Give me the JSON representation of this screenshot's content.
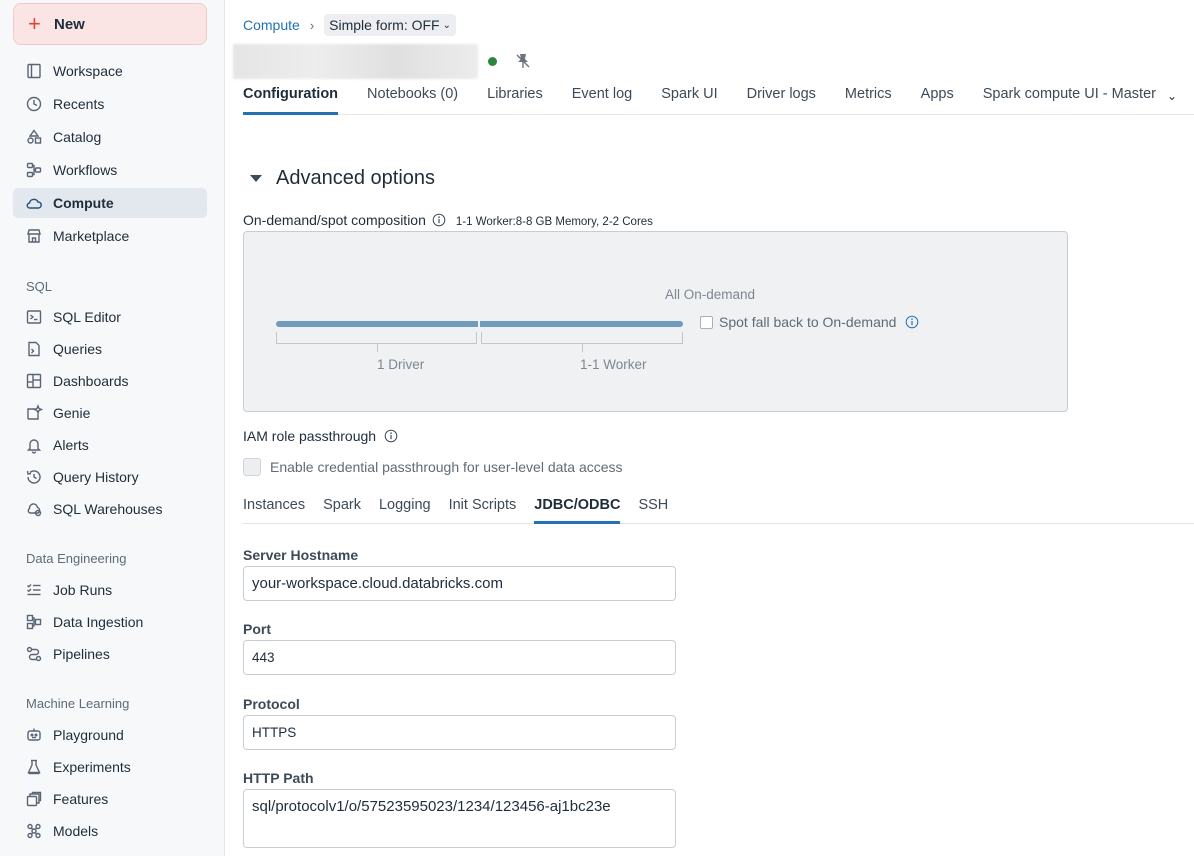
{
  "sidebar": {
    "new_label": "New",
    "items_top": [
      {
        "label": "Workspace",
        "icon": "workspace-icon"
      },
      {
        "label": "Recents",
        "icon": "clock-icon"
      },
      {
        "label": "Catalog",
        "icon": "catalog-icon"
      },
      {
        "label": "Workflows",
        "icon": "workflows-icon"
      },
      {
        "label": "Compute",
        "icon": "cloud-icon",
        "active": true
      },
      {
        "label": "Marketplace",
        "icon": "store-icon"
      }
    ],
    "section_sql": "SQL",
    "items_sql": [
      {
        "label": "SQL Editor",
        "icon": "terminal-icon"
      },
      {
        "label": "Queries",
        "icon": "query-icon"
      },
      {
        "label": "Dashboards",
        "icon": "dashboard-icon"
      },
      {
        "label": "Genie",
        "icon": "genie-icon"
      },
      {
        "label": "Alerts",
        "icon": "bell-icon"
      },
      {
        "label": "Query History",
        "icon": "history-icon"
      },
      {
        "label": "SQL Warehouses",
        "icon": "warehouse-icon"
      }
    ],
    "section_de": "Data Engineering",
    "items_de": [
      {
        "label": "Job Runs",
        "icon": "checklist-icon"
      },
      {
        "label": "Data Ingestion",
        "icon": "ingestion-icon"
      },
      {
        "label": "Pipelines",
        "icon": "pipeline-icon"
      }
    ],
    "section_ml": "Machine Learning",
    "items_ml": [
      {
        "label": "Playground",
        "icon": "robot-icon"
      },
      {
        "label": "Experiments",
        "icon": "flask-icon"
      },
      {
        "label": "Features",
        "icon": "features-icon"
      },
      {
        "label": "Models",
        "icon": "models-icon"
      }
    ]
  },
  "header": {
    "breadcrumb_link": "Compute",
    "breadcrumb_sep": "›",
    "simple_form": "Simple form: OFF",
    "status_color": "#2e8540"
  },
  "tabs": [
    "Configuration",
    "Notebooks (0)",
    "Libraries",
    "Event log",
    "Spark UI",
    "Driver logs",
    "Metrics",
    "Apps",
    "Spark compute UI - Master"
  ],
  "advanced": {
    "title": "Advanced options",
    "composition_label": "On-demand/spot composition",
    "composition_sub": "1-1 Worker:8-8 GB Memory, 2-2 Cores",
    "all_on_demand": "All On-demand",
    "driver_label": "1 Driver",
    "worker_label": "1-1 Worker",
    "spot_fallback": "Spot fall back to On-demand",
    "iam_label": "IAM role passthrough",
    "credential_label": "Enable credential passthrough for user-level data access"
  },
  "subtabs": [
    "Instances",
    "Spark",
    "Logging",
    "Init Scripts",
    "JDBC/ODBC",
    "SSH"
  ],
  "jdbc": {
    "hostname_label": "Server Hostname",
    "hostname_value": "your-workspace.cloud.databricks.com",
    "port_label": "Port",
    "port_value": "443",
    "protocol_label": "Protocol",
    "protocol_value": "HTTPS",
    "path_label": "HTTP Path",
    "path_value": "sql/protocolv1/o/57523595023/1234/123456-aj1bc23e"
  }
}
